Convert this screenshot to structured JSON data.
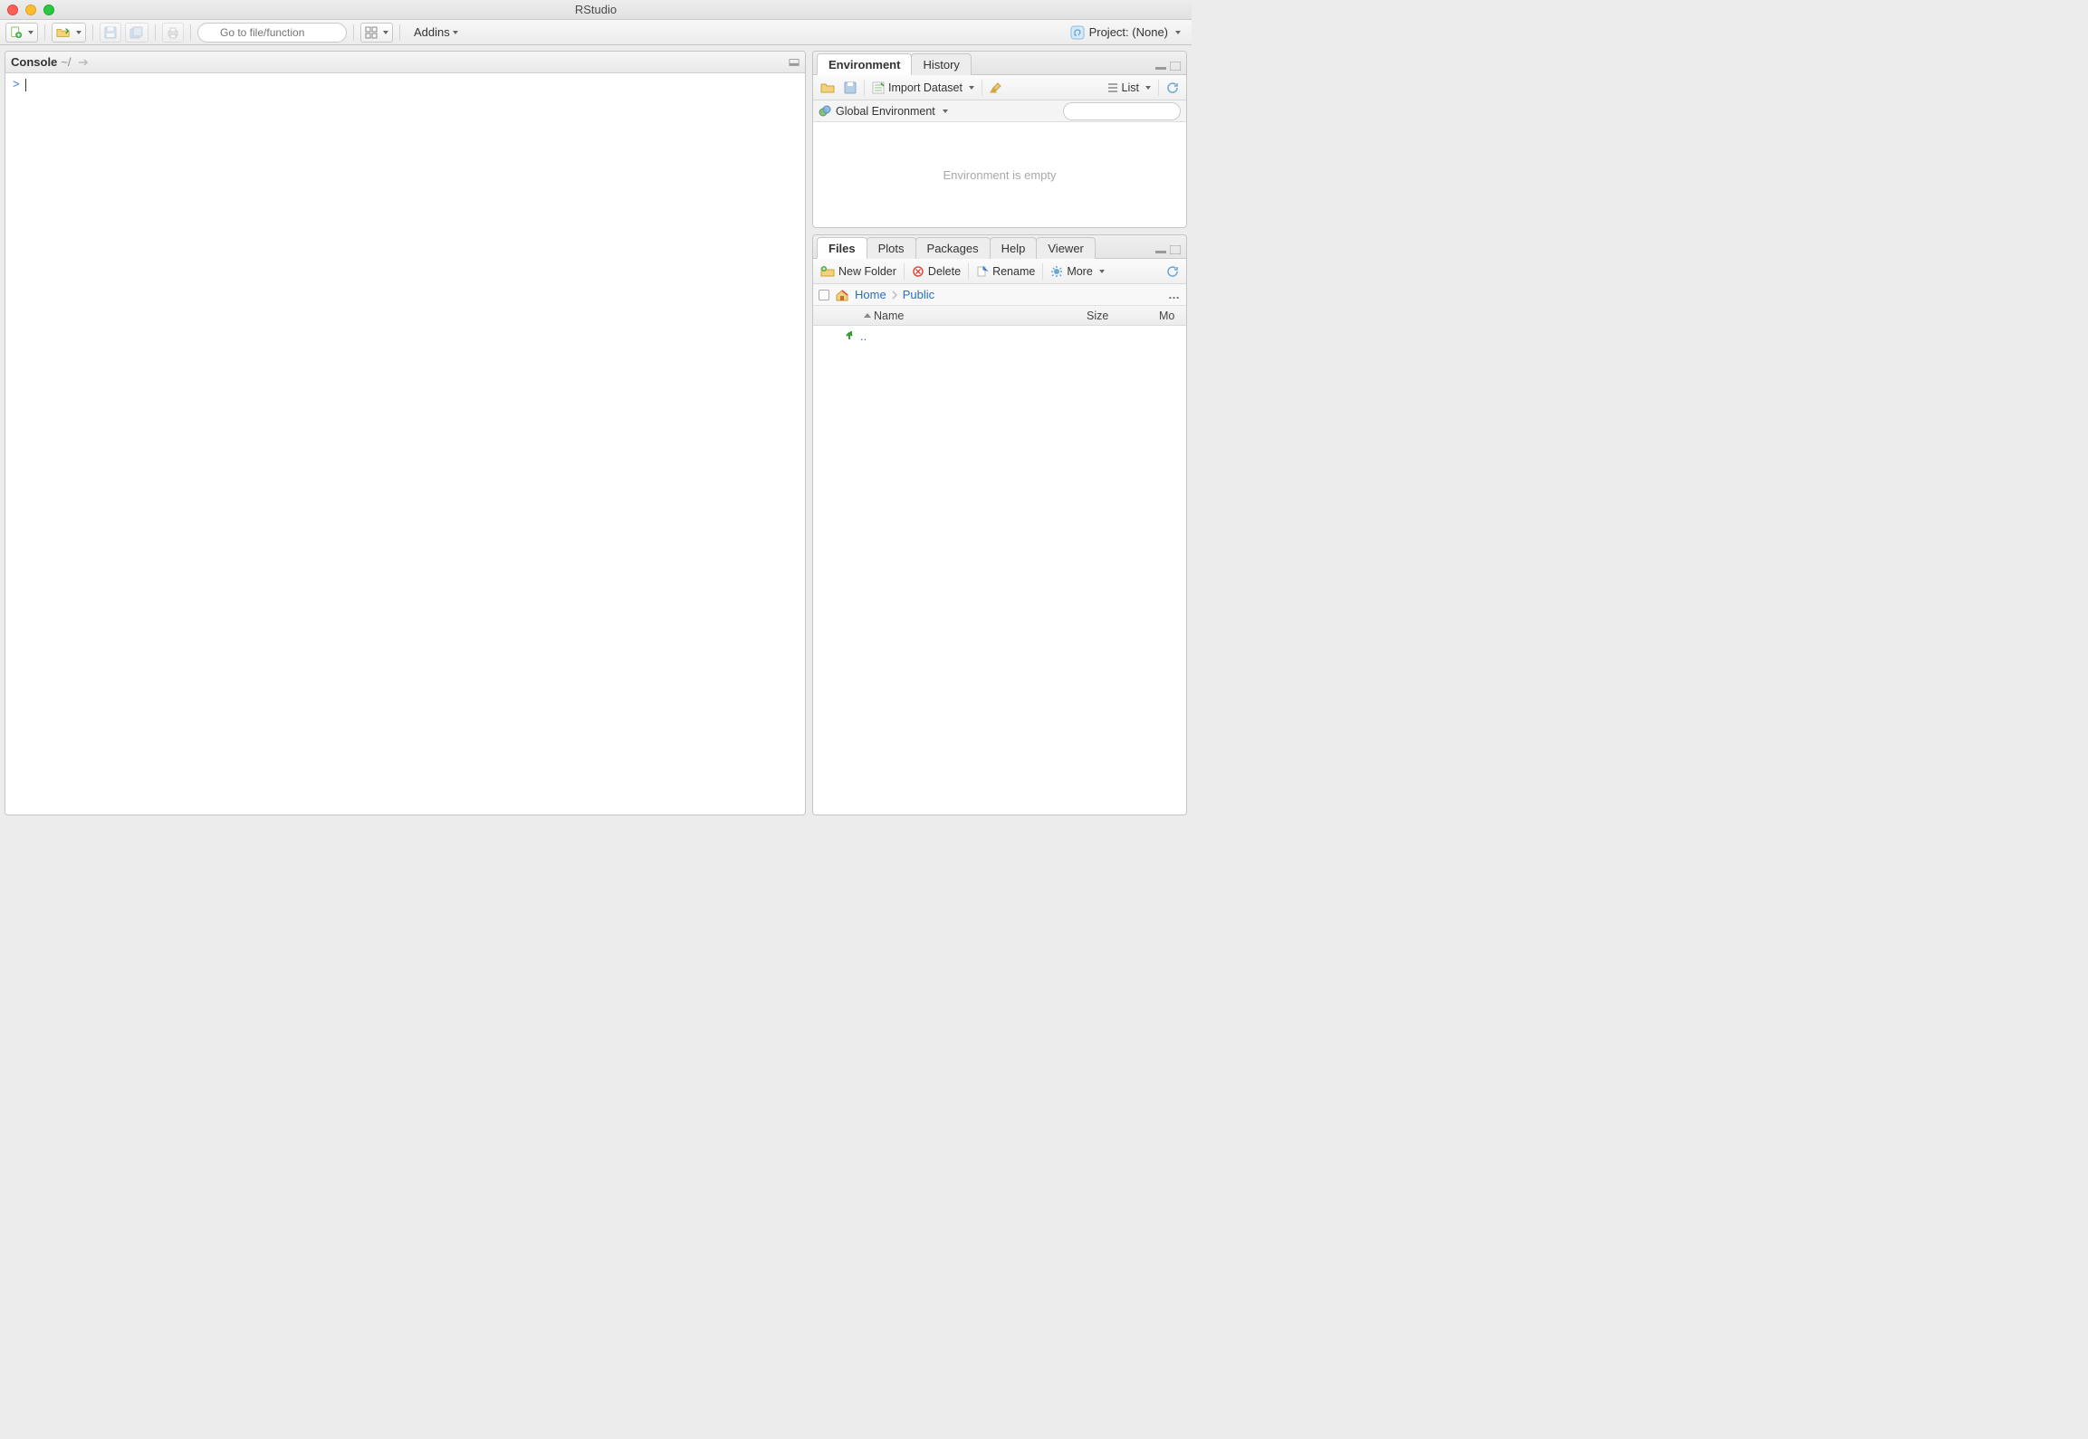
{
  "window": {
    "title": "RStudio"
  },
  "toolbar": {
    "goto_placeholder": "Go to file/function",
    "addins_label": "Addins",
    "project_label": "Project: (None)"
  },
  "console": {
    "title": "Console",
    "path": "~/",
    "prompt": ">"
  },
  "env_pane": {
    "tabs": [
      "Environment",
      "History"
    ],
    "active_tab": 0,
    "import_label": "Import Dataset",
    "list_label": "List",
    "scope_label": "Global Environment",
    "empty_message": "Environment is empty"
  },
  "files_pane": {
    "tabs": [
      "Files",
      "Plots",
      "Packages",
      "Help",
      "Viewer"
    ],
    "active_tab": 0,
    "new_folder_label": "New Folder",
    "delete_label": "Delete",
    "rename_label": "Rename",
    "more_label": "More",
    "breadcrumb": [
      "Home",
      "Public"
    ],
    "columns": {
      "name": "Name",
      "size": "Size",
      "modified": "Mo"
    },
    "up_label": ".."
  }
}
